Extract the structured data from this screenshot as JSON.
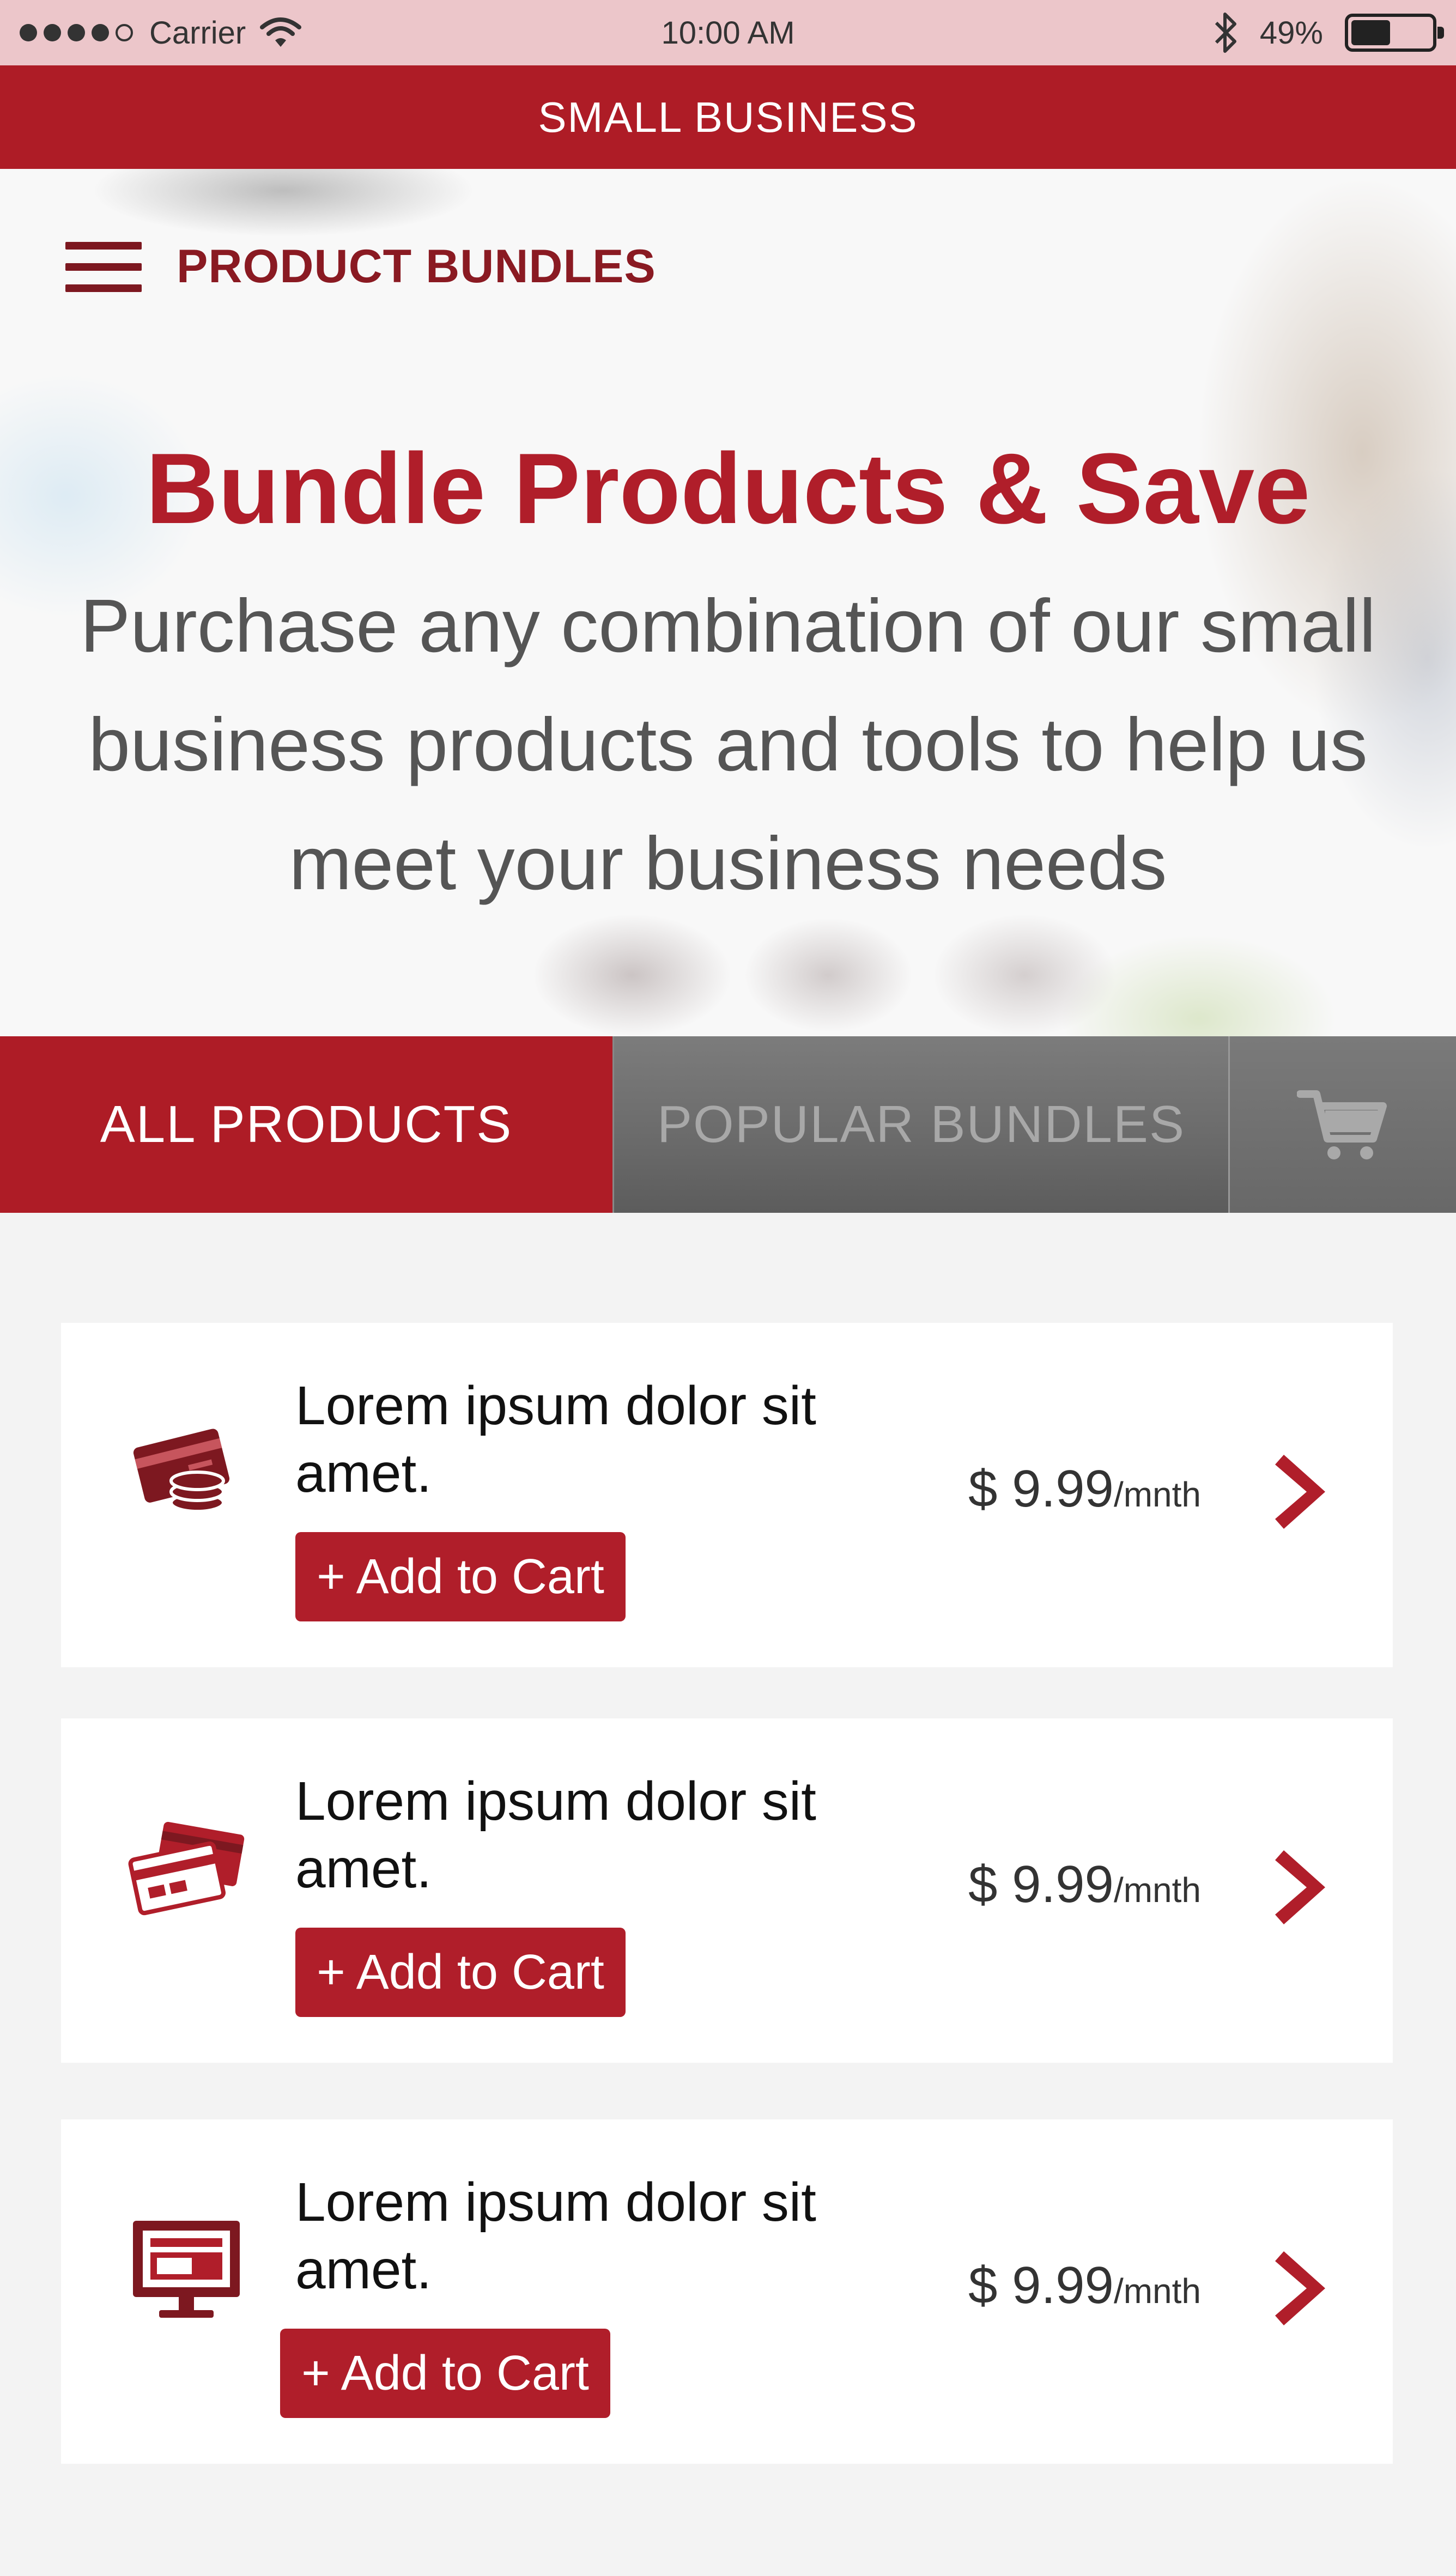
{
  "status_bar": {
    "carrier": "Carrier",
    "time": "10:00 AM",
    "battery": "49%",
    "battery_level": 0.49
  },
  "app_bar": {
    "title": "SMALL BUSINESS"
  },
  "hero": {
    "nav_title": "PRODUCT BUNDLES",
    "title": "Bundle Products & Save",
    "subtitle": "Purchase any combination of our small business products and tools to help us meet your business needs"
  },
  "tabs": [
    {
      "label": "ALL PRODUCTS",
      "active": true
    },
    {
      "label": "POPULAR BUNDLES",
      "active": false
    },
    {
      "icon": "shopping-cart-icon"
    }
  ],
  "products": [
    {
      "icon": "credit-card-coins-icon",
      "title": "Lorem ipsum dolor sit amet.",
      "button": "+ Add to Cart",
      "price": "$ 9.99",
      "unit": "/mnth"
    },
    {
      "icon": "credit-cards-icon",
      "title": "Lorem ipsum dolor sit amet.",
      "button": "+ Add to Cart",
      "price": "$ 9.99",
      "unit": "/mnth"
    },
    {
      "icon": "desktop-monitor-icon",
      "title": "Lorem ipsum dolor sit amet.",
      "button": "+ Add to Cart",
      "price": "$ 9.99",
      "unit": "/mnth"
    }
  ],
  "colors": {
    "brand": "#ae1c26",
    "dark_brand": "#7d1820",
    "status_bar": "#ecc6ca",
    "background": "#f3f3f3"
  }
}
